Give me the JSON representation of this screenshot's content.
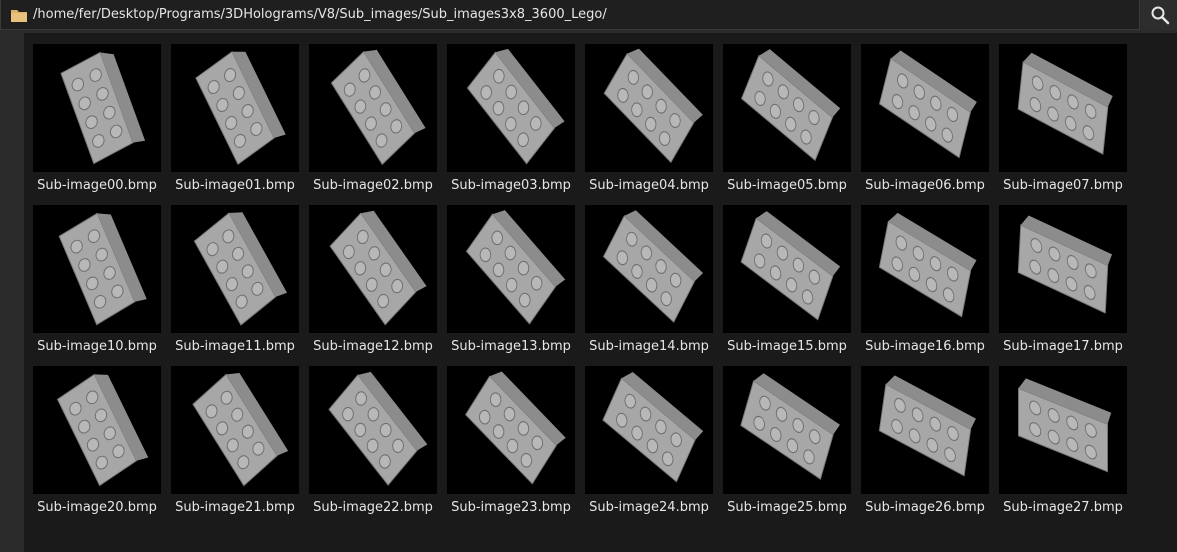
{
  "pathbar": {
    "path": "/home/fer/Desktop/Programs/3DHolograms/V8/Sub_images/Sub_images3x8_3600_Lego/"
  },
  "icons": {
    "folder": "folder-icon",
    "search": "search-icon"
  },
  "colors": {
    "brick": "#a7a7a7",
    "folder": "#d9b36c"
  },
  "files": [
    "Sub-image00.bmp",
    "Sub-image01.bmp",
    "Sub-image02.bmp",
    "Sub-image03.bmp",
    "Sub-image04.bmp",
    "Sub-image05.bmp",
    "Sub-image06.bmp",
    "Sub-image07.bmp",
    "Sub-image10.bmp",
    "Sub-image11.bmp",
    "Sub-image12.bmp",
    "Sub-image13.bmp",
    "Sub-image14.bmp",
    "Sub-image15.bmp",
    "Sub-image16.bmp",
    "Sub-image17.bmp",
    "Sub-image20.bmp",
    "Sub-image21.bmp",
    "Sub-image22.bmp",
    "Sub-image23.bmp",
    "Sub-image24.bmp",
    "Sub-image25.bmp",
    "Sub-image26.bmp",
    "Sub-image27.bmp"
  ]
}
